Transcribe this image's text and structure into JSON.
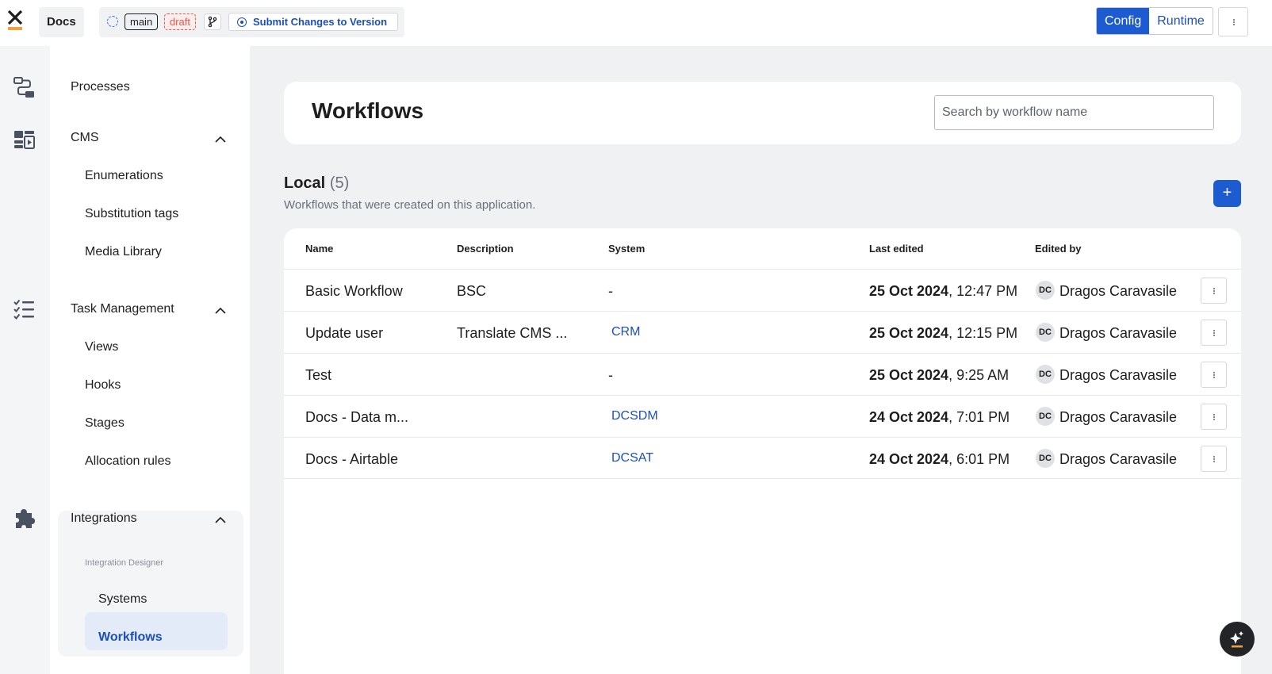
{
  "topbar": {
    "app_name": "Docs",
    "branch": "main",
    "status": "draft",
    "submit_label": "Submit Changes to Version",
    "mode_config": "Config",
    "mode_runtime": "Runtime"
  },
  "rail": {
    "icons": [
      "processes-icon",
      "cms-icon",
      "task-management-icon",
      "integrations-icon"
    ]
  },
  "sidebar": {
    "processes": "Processes",
    "cms": {
      "label": "CMS",
      "items": [
        "Enumerations",
        "Substitution tags",
        "Media Library"
      ]
    },
    "task_management": {
      "label": "Task Management",
      "items": [
        "Views",
        "Hooks",
        "Stages",
        "Allocation rules"
      ]
    },
    "integrations": {
      "label": "Integrations",
      "caption": "Integration Designer",
      "items": [
        "Systems",
        "Workflows"
      ],
      "active": "Workflows"
    }
  },
  "main": {
    "title": "Workflows",
    "search_placeholder": "Search by workflow name",
    "section_title": "Local",
    "section_count": "(5)",
    "section_subtitle": "Workflows that were created on this application.",
    "add_label": "+"
  },
  "table": {
    "columns": [
      "Name",
      "Description",
      "System",
      "Last edited",
      "Edited by"
    ],
    "rows": [
      {
        "name": "Basic Workflow",
        "description": "BSC",
        "system": "-",
        "system_link": false,
        "date": "25 Oct 2024",
        "time": ", 12:47 PM",
        "initials": "DC",
        "editor": "Dragos Caravasile"
      },
      {
        "name": "Update user",
        "description": "Translate CMS ...",
        "system": "CRM",
        "system_link": true,
        "date": "25 Oct 2024",
        "time": ", 12:15 PM",
        "initials": "DC",
        "editor": "Dragos Caravasile"
      },
      {
        "name": "Test",
        "description": "",
        "system": "-",
        "system_link": false,
        "date": "25 Oct 2024",
        "time": ", 9:25 AM",
        "initials": "DC",
        "editor": "Dragos Caravasile"
      },
      {
        "name": "Docs - Data m...",
        "description": "",
        "system": "DCSDM",
        "system_link": true,
        "date": "24 Oct 2024",
        "time": ", 7:01 PM",
        "initials": "DC",
        "editor": "Dragos Caravasile"
      },
      {
        "name": "Docs - Airtable",
        "description": "",
        "system": "DCSAT",
        "system_link": true,
        "date": "24 Oct 2024",
        "time": ", 6:01 PM",
        "initials": "DC",
        "editor": "Dragos Caravasile"
      }
    ]
  },
  "colors": {
    "accent": "#1d5bd1",
    "link": "#1d4fb8",
    "draft": "#e15a4a",
    "logo_orange": "#f0a03c"
  }
}
